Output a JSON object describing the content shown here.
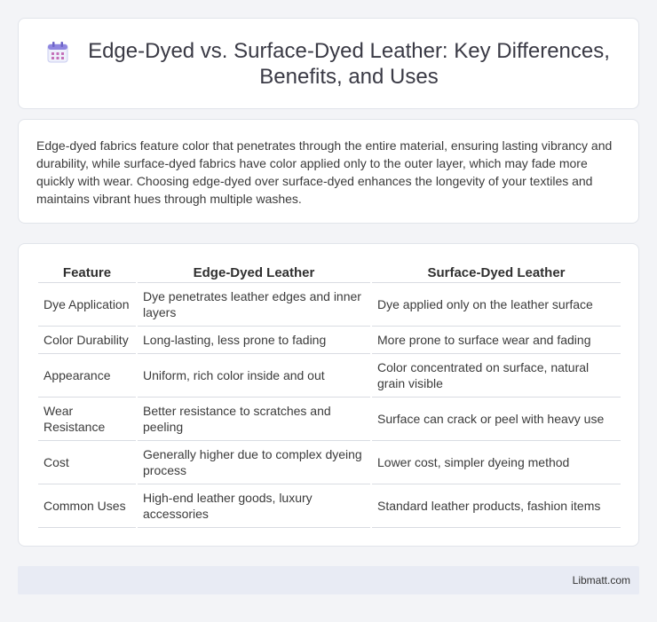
{
  "header": {
    "title": "Edge-Dyed vs. Surface-Dyed Leather: Key Differences, Benefits, and Uses",
    "icon": "calendar-icon"
  },
  "intro": {
    "text": "Edge-dyed fabrics feature color that penetrates through the entire material, ensuring lasting vibrancy and durability, while surface-dyed fabrics have color applied only to the outer layer, which may fade more quickly with wear. Choosing edge-dyed over surface-dyed enhances the longevity of your textiles and maintains vibrant hues through multiple washes."
  },
  "table": {
    "headers": [
      "Feature",
      "Edge-Dyed Leather",
      "Surface-Dyed Leather"
    ],
    "rows": [
      [
        "Dye Application",
        "Dye penetrates leather edges and inner layers",
        "Dye applied only on the leather surface"
      ],
      [
        "Color Durability",
        "Long-lasting, less prone to fading",
        "More prone to surface wear and fading"
      ],
      [
        "Appearance",
        "Uniform, rich color inside and out",
        "Color concentrated on surface, natural grain visible"
      ],
      [
        "Wear Resistance",
        "Better resistance to scratches and peeling",
        "Surface can crack or peel with heavy use"
      ],
      [
        "Cost",
        "Generally higher due to complex dyeing process",
        "Lower cost, simpler dyeing method"
      ],
      [
        "Common Uses",
        "High-end leather goods, luxury accessories",
        "Standard leather products, fashion items"
      ]
    ]
  },
  "footer": {
    "text": "Libmatt.com"
  },
  "colors": {
    "background": "#f3f4f7",
    "card": "#ffffff",
    "footer_bg": "#e8ebf4",
    "icon_accent": "#7b6fd6"
  }
}
